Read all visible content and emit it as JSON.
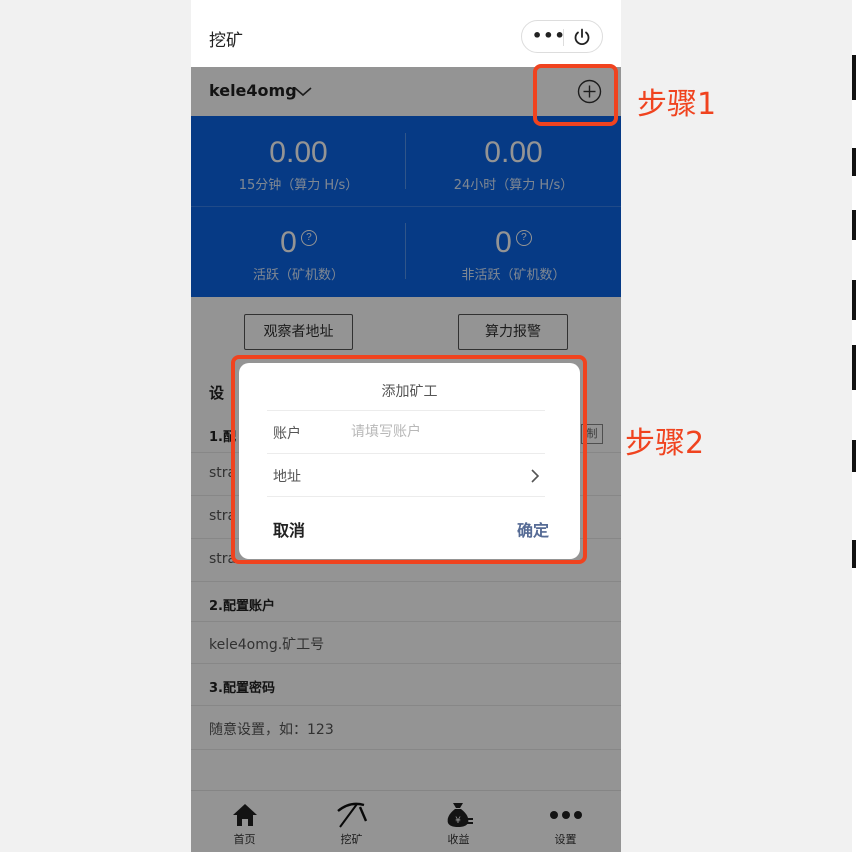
{
  "navbar": {
    "title": "挖矿",
    "more_glyph": "•••",
    "power_glyph": "⏻"
  },
  "account": {
    "name": "kele4omg"
  },
  "stats": [
    {
      "value": "0.00",
      "label": "15分钟（算力 H/s）"
    },
    {
      "value": "0.00",
      "label": "24小时（算力 H/s）"
    },
    {
      "value": "0",
      "label": "活跃（矿机数）",
      "help": "?"
    },
    {
      "value": "0",
      "label": "非活跃（矿机数）",
      "help": "?"
    }
  ],
  "buttons": {
    "observer": "观察者地址",
    "alarm": "算力报警"
  },
  "settings": {
    "title_visible": "设",
    "step1_visible": "1.配",
    "strat_rows": [
      "stra",
      "stra",
      "stra"
    ],
    "copy_visible": "制",
    "step2": "2.配置账户",
    "account_value": "kele4omg.矿工号",
    "step3": "3.配置密码",
    "password_hint": "随意设置，如：123"
  },
  "tabs": [
    {
      "label": "首页",
      "icon": "home-icon"
    },
    {
      "label": "挖矿",
      "icon": "pickaxe-icon"
    },
    {
      "label": "收益",
      "icon": "money-bag-icon"
    },
    {
      "label": "设置",
      "icon": "more-dots-icon"
    }
  ],
  "dialog": {
    "title": "添加矿工",
    "account_label": "账户",
    "account_placeholder": "请填写账户",
    "address_label": "地址",
    "cancel": "取消",
    "confirm": "确定"
  },
  "annotations": {
    "step1": "步骤1",
    "step2": "步骤2"
  },
  "colors": {
    "primary_blue": "#0b65e6",
    "highlight": "#f0431f",
    "confirm": "#566b95"
  }
}
